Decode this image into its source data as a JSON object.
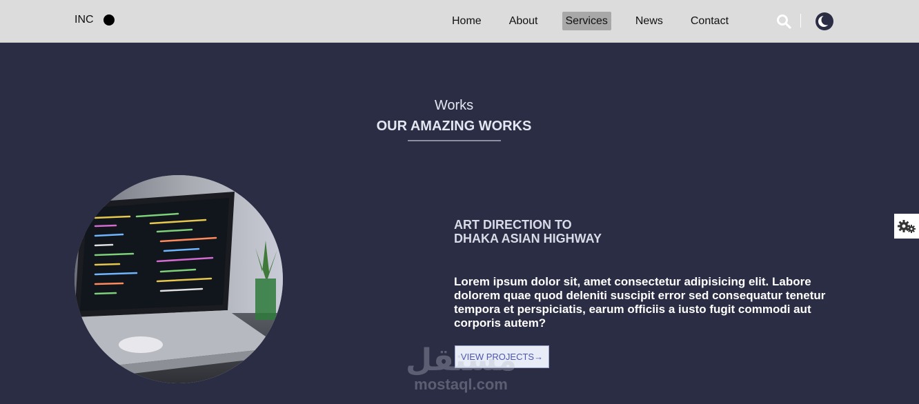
{
  "nav": {
    "brand": "INC",
    "links": [
      {
        "label": "Home",
        "active": false
      },
      {
        "label": "About",
        "active": false
      },
      {
        "label": "Services",
        "active": true
      },
      {
        "label": "News",
        "active": false
      },
      {
        "label": "Contact",
        "active": false
      }
    ],
    "search_icon": "search-icon",
    "theme_icon": "moon-icon"
  },
  "section": {
    "kicker": "Works",
    "title": "OUR AMAZING WORKS"
  },
  "work": {
    "image_alt": "laptop-with-code",
    "title": "ART DIRECTION TO DHAKA ASIAN HIGHWAY",
    "description": "Lorem ipsum dolor sit, amet consectetur adipisicing elit. Labore dolorem quae quod deleniti suscipit error sed consequatur tenetur tempora et perspiciatis, earum officiis a iusto fugit commodi aut corporis autem?",
    "button_label": "VIEW PROJECTS→"
  },
  "settings_icon": "gears-icon",
  "watermark": {
    "arabic": "مستقل",
    "latin": "mostaql.com"
  },
  "colors": {
    "nav_bg": "#dcdcdc",
    "page_bg": "#2b2d44",
    "active_link_bg": "#a8a8a8",
    "button_text": "#4b55b0"
  }
}
